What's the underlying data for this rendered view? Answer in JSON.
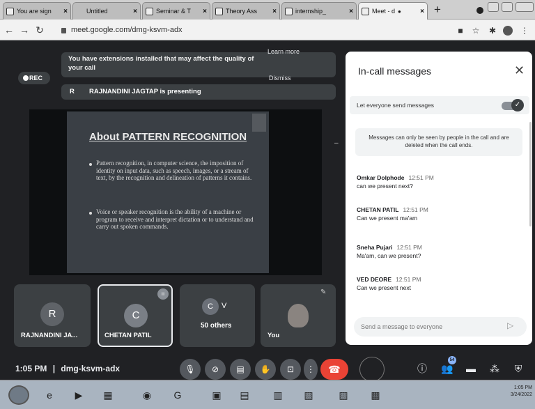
{
  "browser": {
    "tabs": [
      {
        "label": "You are sign",
        "active": false
      },
      {
        "label": "Untitled",
        "active": false
      },
      {
        "label": "Seminar & T",
        "active": false
      },
      {
        "label": "Theory Ass",
        "active": false
      },
      {
        "label": "internship_",
        "active": false
      },
      {
        "label": "Meet - d",
        "active": true
      }
    ],
    "new_tab": "+",
    "url": "meet.google.com/dmg-ksvm-adx"
  },
  "stage": {
    "rec_label": "REC",
    "extensions_banner": "You have extensions installed that may affect the quality of your call",
    "learn_more": "Learn more",
    "dismiss": "Dismiss",
    "presenter_initial": "R",
    "presenting_text": "RAJNANDINI JAGTAP is presenting",
    "slide": {
      "title": "About PATTERN RECOGNITION",
      "bullet1": "Pattern recognition, in computer science, the imposition of identity on input data, such as speech, images, or a stream of text, by the recognition and delineation of patterns it contains.",
      "bullet2": "Voice or speaker recognition is the ability of a machine or program to receive and interpret dictation or to understand and carry out spoken commands."
    }
  },
  "tiles": [
    {
      "initial": "R",
      "name": "RAJNANDINI JA...",
      "color": "#5f6368"
    },
    {
      "initial": "C",
      "name": "CHETAN PATIL",
      "color": "#7a7f86"
    },
    {
      "initial": "C",
      "initial2": "V",
      "name": "50 others",
      "color": "#6b7078"
    },
    {
      "initial": "",
      "name": "You",
      "color": "#3c4043"
    }
  ],
  "bottom_bar": {
    "time": "1:05 PM",
    "separator": "|",
    "meeting_code": "dmg-ksvm-adx",
    "people_count": "54"
  },
  "chat": {
    "title": "In-call messages",
    "toggle_label": "Let everyone send messages",
    "notice": "Messages can only be seen by people in the call and are deleted when the call ends.",
    "messages": [
      {
        "sender": "Omkar Dolphode",
        "time": "12:51 PM",
        "text": "can we present next?"
      },
      {
        "sender": "CHETAN PATIL",
        "time": "12:51 PM",
        "text": "Can we present ma'am"
      },
      {
        "sender": "Sneha Pujari",
        "time": "12:51 PM",
        "text": "Ma'am, can we present?"
      },
      {
        "sender": "VED DEORE",
        "time": "12:51 PM",
        "text": "Can we present next"
      }
    ],
    "input_placeholder": "Send a message to everyone"
  },
  "taskbar": {
    "time": "1:05 PM",
    "date": "3/24/2022"
  },
  "colors": {
    "meet_dark": "#202124",
    "tile_bg": "#3c4043",
    "end_call": "#ea4335"
  }
}
